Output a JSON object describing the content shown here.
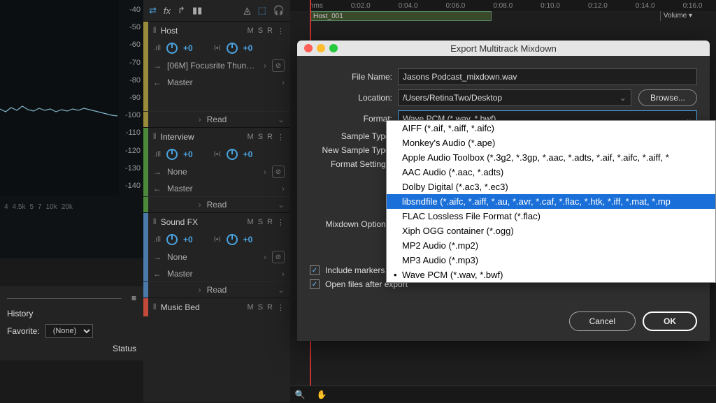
{
  "db_scale": [
    "-40",
    "-50",
    "-60",
    "-70",
    "-80",
    "-90",
    "-100",
    "-110",
    "-120",
    "-130",
    "-140"
  ],
  "freq_scale": [
    "4",
    "4.5k",
    "5",
    "7",
    "10k",
    "20k"
  ],
  "history": {
    "title": "History",
    "fav_label": "Favorite:",
    "fav_value": "(None)",
    "status_label": "Status"
  },
  "timeline": {
    "times": [
      "hms",
      "0:02.0",
      "0:04.0",
      "0:06.0",
      "0:08.0",
      "0:10.0",
      "0:12.0",
      "0:14.0",
      "0:16.0"
    ],
    "clip_name": "Host_001",
    "volume_label": "Volume"
  },
  "tracks": [
    {
      "name": "Host",
      "m": "M",
      "s": "S",
      "r": "R",
      "plus": "+0",
      "plus2": "+0",
      "route": "[06M] Focusrite Thun…",
      "master": "Master",
      "read": "Read",
      "color": "#9a8b3a"
    },
    {
      "name": "Interview",
      "m": "M",
      "s": "S",
      "r": "R",
      "plus": "+0",
      "plus2": "+0",
      "none": "None",
      "master": "Master",
      "read": "Read",
      "color": "#4a8a3a"
    },
    {
      "name": "Sound FX",
      "m": "M",
      "s": "S",
      "r": "R",
      "plus": "+0",
      "plus2": "+0",
      "none": "None",
      "master": "Master",
      "read": "Read",
      "color": "#4a7aaa"
    },
    {
      "name": "Music Bed",
      "m": "M",
      "s": "S",
      "r": "R",
      "color": "#c34a3a"
    }
  ],
  "dialog": {
    "title": "Export Multitrack Mixdown",
    "file_name_label": "File Name:",
    "file_name": "Jasons Podcast_mixdown.wav",
    "location_label": "Location:",
    "location": "/Users/RetinaTwo/Desktop",
    "browse": "Browse...",
    "format_label": "Format:",
    "format_selected": "Wave PCM (*.wav, *.bwf)",
    "sample_type_label": "Sample Type:",
    "new_sample_label": "New Sample Type:",
    "format_settings_label": "Format Settings:",
    "mixdown_label": "Mixdown Options:",
    "check1": "Include markers and other metadata",
    "check2": "Open files after export",
    "cancel": "Cancel",
    "ok": "OK"
  },
  "format_options": [
    "AIFF (*.aif, *.aiff, *.aifc)",
    "Monkey's Audio (*.ape)",
    "Apple Audio Toolbox (*.3g2, *.3gp, *.aac, *.adts, *.aif, *.aifc, *.aiff, *",
    "AAC Audio (*.aac, *.adts)",
    "Dolby Digital (*.ac3, *.ec3)",
    "libsndfile (*.aifc, *.aiff, *.au, *.avr, *.caf, *.flac, *.htk, *.iff, *.mat, *.mp",
    "FLAC Lossless File Format (*.flac)",
    "Xiph OGG container (*.ogg)",
    "MP2 Audio (*.mp2)",
    "MP3 Audio (*.mp3)",
    "Wave PCM (*.wav, *.bwf)"
  ],
  "format_highlight_index": 5,
  "format_bullet_index": 10
}
